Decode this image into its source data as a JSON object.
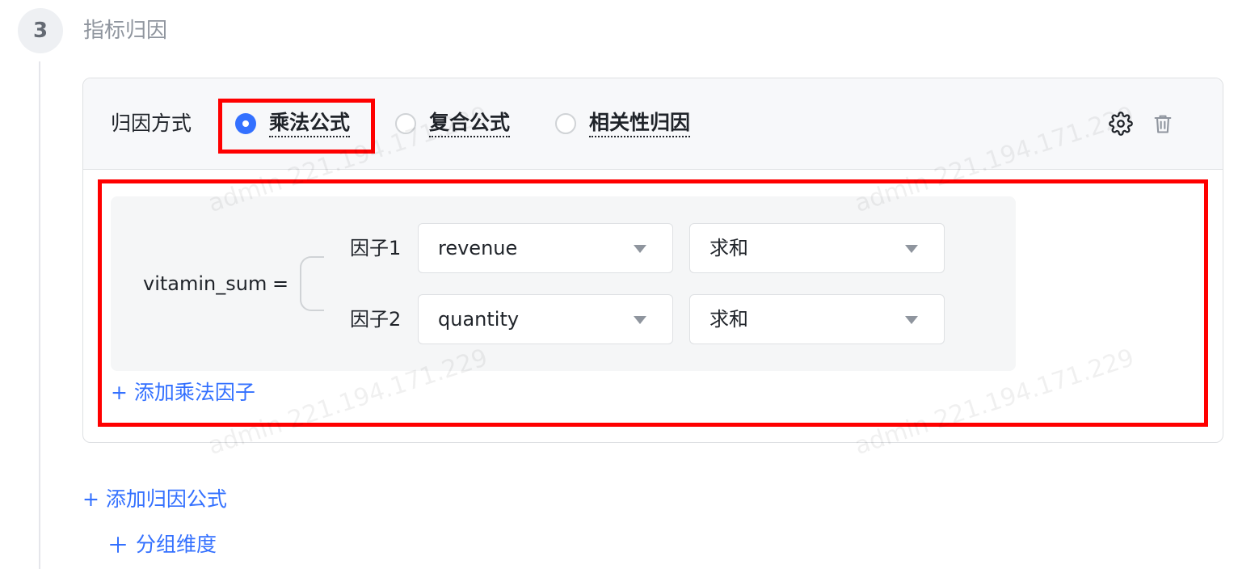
{
  "step": {
    "number": "3",
    "title": "指标归因"
  },
  "header": {
    "method_label": "归因方式",
    "options": [
      {
        "label": "乘法公式",
        "checked": true
      },
      {
        "label": "复合公式",
        "checked": false
      },
      {
        "label": "相关性归因",
        "checked": false
      }
    ]
  },
  "formula": {
    "metric": "vitamin_sum",
    "equals": "=",
    "factors": [
      {
        "label": "因子1",
        "field": "revenue",
        "aggregation": "求和"
      },
      {
        "label": "因子2",
        "field": "quantity",
        "aggregation": "求和"
      }
    ],
    "add_factor_link": "+ 添加乘法因子"
  },
  "actions": {
    "add_formula_link": "+ 添加归因公式",
    "group_dimension_link": "分组维度"
  },
  "watermark": "admin 221.194.171.229",
  "colors": {
    "primary": "#3370ff",
    "highlight": "#ff0000",
    "header_bg": "#f7f8fa",
    "formula_bg": "#f5f6f7"
  }
}
